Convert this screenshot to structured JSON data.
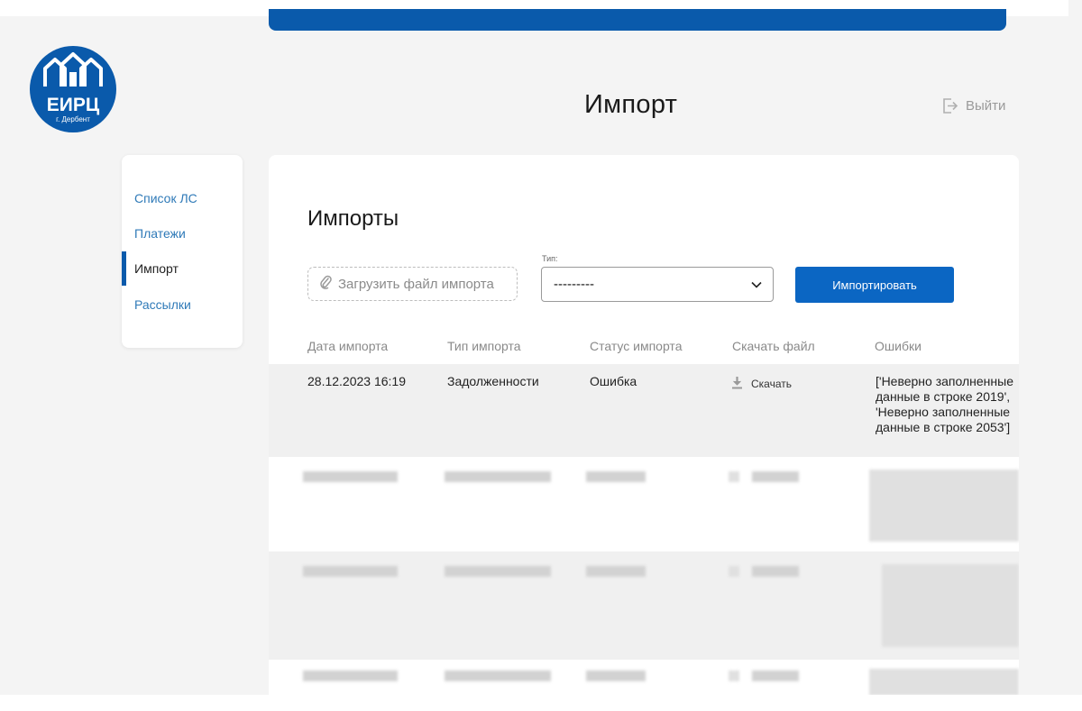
{
  "header": {
    "logo": {
      "text": "ЕИРЦ",
      "subtext": "г. Дербент",
      "color": "#0a5aab"
    },
    "page_title": "Импорт",
    "logout": {
      "label": "Выйти",
      "icon": "logout-icon"
    }
  },
  "sidebar": {
    "items": [
      {
        "label": "Список ЛС",
        "active": false
      },
      {
        "label": "Платежи",
        "active": false
      },
      {
        "label": "Импорт",
        "active": true
      },
      {
        "label": "Рассылки",
        "active": false
      }
    ]
  },
  "main": {
    "title": "Импорты",
    "upload": {
      "label": "Загрузить файл импорта",
      "icon": "paperclip-icon"
    },
    "type_select": {
      "label": "Тип:",
      "value": "---------"
    },
    "import_button": "Импортировать",
    "table": {
      "columns": [
        "Дата импорта",
        "Тип импорта",
        "Статус импорта",
        "Скачать файл",
        "Ошибки"
      ],
      "rows": [
        {
          "date": "28.12.2023 16:19",
          "type": "Задолженности",
          "status": "Ошибка",
          "download": "Скачать",
          "errors": "['Неверно заполненные данные в строке 2019', 'Неверно заполненные данные в строке 2053']"
        }
      ]
    }
  },
  "colors": {
    "brand_blue": "#0a5aab",
    "button_blue": "#0b66c3",
    "link_blue": "#2f7ab8",
    "row_gray": "#f0f0f0"
  }
}
